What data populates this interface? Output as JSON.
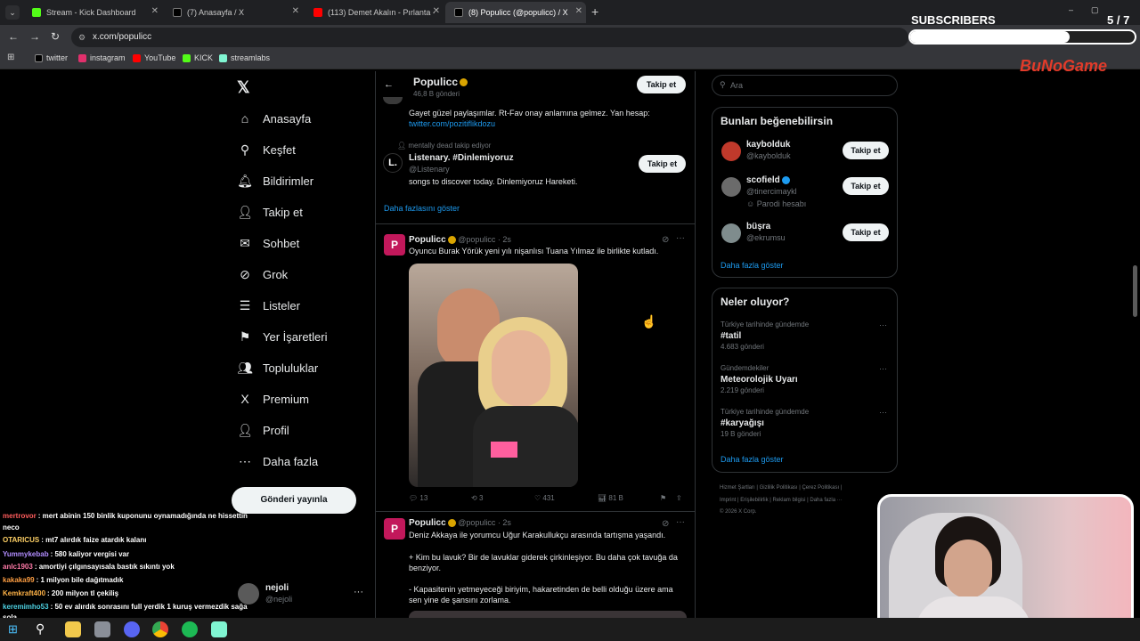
{
  "browser": {
    "tabs": [
      {
        "title": "Stream - Kick Dashboard",
        "color": "#53fc18"
      },
      {
        "title": "(7) Anasayfa / X",
        "color": "#ffffff"
      },
      {
        "title": "(113) Demet Akalın - Pırlanta -",
        "color": "#ff0000"
      },
      {
        "title": "(8) Populicc (@populicc) / X",
        "color": "#ffffff"
      }
    ],
    "url": "x.com/populicc",
    "bookmarks": [
      {
        "label": "twitter",
        "color": "#ffffff"
      },
      {
        "label": "instagram",
        "color": "#e1306c"
      },
      {
        "label": "YouTube",
        "color": "#ff0000"
      },
      {
        "label": "KICK",
        "color": "#53fc18"
      },
      {
        "label": "streamlabs",
        "color": "#80f5d2"
      }
    ]
  },
  "overlay": {
    "subscribers_label": "SUBSCRIBERS",
    "subscribers_count": "5 / 7",
    "subscribers_progress": 0.71,
    "brand": "BuNoGame"
  },
  "nav": {
    "items": [
      {
        "label": "Anasayfa",
        "icon": "home-icon",
        "glyph": "⌂"
      },
      {
        "label": "Keşfet",
        "icon": "search-icon",
        "glyph": "⚲"
      },
      {
        "label": "Bildirimler",
        "icon": "bell-icon",
        "glyph": "🔔︎"
      },
      {
        "label": "Takip et",
        "icon": "follow-user-icon",
        "glyph": "👤︎"
      },
      {
        "label": "Sohbet",
        "icon": "message-icon",
        "glyph": "✉"
      },
      {
        "label": "Grok",
        "icon": "grok-icon",
        "glyph": "⊘"
      },
      {
        "label": "Listeler",
        "icon": "list-icon",
        "glyph": "☰"
      },
      {
        "label": "Yer İşaretleri",
        "icon": "bookmark-icon",
        "glyph": "⚑"
      },
      {
        "label": "Topluluklar",
        "icon": "communities-icon",
        "glyph": "👥︎"
      },
      {
        "label": "Premium",
        "icon": "x-icon",
        "glyph": "X"
      },
      {
        "label": "Profil",
        "icon": "profile-icon",
        "glyph": "👤︎"
      },
      {
        "label": "Daha fazla",
        "icon": "more-circle-icon",
        "glyph": "⋯"
      }
    ],
    "post_button": "Gönderi yayınla",
    "account_name": "nejoli",
    "account_handle": "@nejoli"
  },
  "profile_header": {
    "name": "Populicc",
    "posts": "46,8 B gönderi",
    "follow": "Takip et"
  },
  "suggest": {
    "bio1": "Gayet güzel paylaşımlar. Rt-Fav onay anlamına gelmez. Yan hesap:",
    "bio1_link": "twitter.com/pozitiflikdozu",
    "context": "mentally dead takip ediyor",
    "name2": "Listenary. #Dinlemiyoruz",
    "handle2": "@Listenary",
    "bio2": "songs to discover today. Dinlemiyoruz Hareketi.",
    "follow": "Takip et",
    "show_more": "Daha fazlasını göster"
  },
  "tweet1": {
    "name": "Populicc",
    "handle": "@populicc · 2s",
    "text": "Oyuncu Burak Yörük yeni yılı nişanlısı Tuana Yılmaz ile birlikte kutladı.",
    "replies": "13",
    "retweets": "3",
    "likes": "431",
    "views": "81 B"
  },
  "tweet2": {
    "name": "Populicc",
    "handle": "@populicc · 2s",
    "line1": "Deniz Akkaya ile yorumcu Uğur Karakullukçu arasında tartışma yaşandı.",
    "line2": "+ Kim bu lavuk? Bir de lavuklar giderek çirkinleşiyor. Bu daha çok tavuğa da benziyor.",
    "line3": "- Kapasitenin yetmeyeceği biriyim, hakaretinden de belli olduğu üzere ama sen yine de şansını zorlama."
  },
  "right": {
    "search_placeholder": "Ara",
    "wtf_title": "Bunları beğenebilirsin",
    "people": [
      {
        "name": "kaybolduk",
        "handle": "@kaybolduk",
        "extra": "",
        "verified": false
      },
      {
        "name": "scofield",
        "handle": "@tinercimaykl",
        "extra": "Parodi hesabı",
        "verified": true
      },
      {
        "name": "büşra",
        "handle": "@ekrumsu",
        "extra": "",
        "verified": false
      }
    ],
    "follow": "Takip et",
    "show_more": "Daha fazla göster",
    "trends_title": "Neler oluyor?",
    "trends": [
      {
        "context": "Türkiye tarihinde gündemde",
        "tag": "#tatil",
        "count": "4.683 gönderi"
      },
      {
        "context": "Gündemdekiler",
        "tag": "Meteorolojik Uyarı",
        "count": "2.219 gönderi"
      },
      {
        "context": "Türkiye tarihinde gündemde",
        "tag": "#karyağışı",
        "count": "19 B gönderi"
      }
    ],
    "trends_more": "Daha fazla göster",
    "footer1": "Hizmet Şartları | Gizlilik Politikası | Çerez Politikası |",
    "footer2": "Imprint | Erişilebilirlik | Reklam bilgisi | Daha fazla ···",
    "footer3": "© 2026 X Corp."
  },
  "chat": [
    {
      "user": "mertrovor",
      "color": "#ff5c5c",
      "text": ": mert abinin 150 binlik kuponunu oynamadığında ne hissettin"
    },
    {
      "user": "",
      "color": "#ffffff",
      "text": "neco"
    },
    {
      "user": "OTARICUS",
      "color": "#ffd166",
      "text": ": mt7 alırdık faize atardık kalanı"
    },
    {
      "user": "Yummykebab",
      "color": "#b28dff",
      "text": ": 580 kaliyor vergisi var"
    },
    {
      "user": "anlc1903",
      "color": "#ff7aa8",
      "text": ": amortiyi çılgınsayısala bastık sıkıntı yok"
    },
    {
      "user": "kakaka99",
      "color": "#ff9f43",
      "text": ": 1 milyon bile dağıtmadık"
    },
    {
      "user": "Kemkraft400",
      "color": "#ffb347",
      "text": ": 200 milyon tl çekiliş"
    },
    {
      "user": "keremimho53",
      "color": "#4dd0e1",
      "text": ": 50 ev alırdık sonrasını full yerdik 1 kuruş vermezdik sağa"
    },
    {
      "user": "",
      "color": "#ffffff",
      "text": "sola"
    }
  ]
}
